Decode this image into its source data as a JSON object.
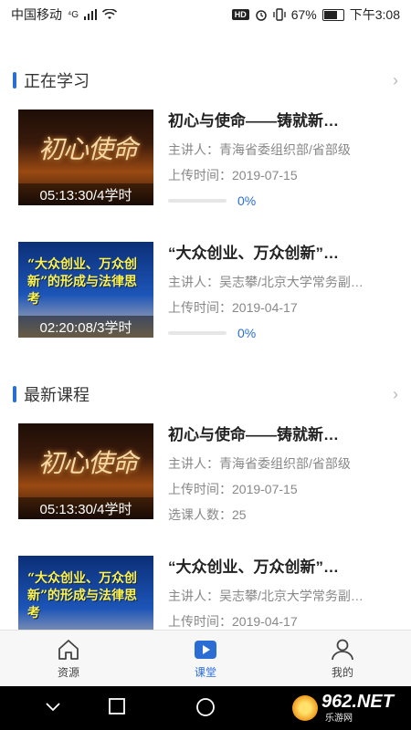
{
  "status": {
    "carrier": "中国移动",
    "network": "⁴G",
    "battery": "67%",
    "time": "下午3:08",
    "hd_badge": "HD"
  },
  "colors": {
    "accent": "#2a6ed4",
    "text": "#222222",
    "muted": "#888888"
  },
  "sections": [
    {
      "title": "正在学习",
      "courses": [
        {
          "title": "初心与使命——铸就新…",
          "speaker": "主讲人：青海省委组织部/省部级",
          "upload": "上传时间：2019-07-15",
          "duration": "05:13:30/4学时",
          "progress": "0%",
          "progress_value": 0,
          "thumb_text": "初心使命"
        },
        {
          "title": "“大众创业、万众创新”…",
          "speaker": "主讲人：吴志攀/北京大学常务副…",
          "upload": "上传时间：2019-04-17",
          "duration": "02:20:08/3学时",
          "progress": "0%",
          "progress_value": 0,
          "thumb_text": "“大众创业、万众创新”的形成与法律思考"
        }
      ]
    },
    {
      "title": "最新课程",
      "courses": [
        {
          "title": "初心与使命——铸就新…",
          "speaker": "主讲人：青海省委组织部/省部级",
          "upload": "上传时间：2019-07-15",
          "duration": "05:13:30/4学时",
          "enrolled": "选课人数：25",
          "thumb_text": "初心使命"
        },
        {
          "title": "“大众创业、万众创新”…",
          "speaker": "主讲人：吴志攀/北京大学常务副…",
          "upload": "上传时间：2019-04-17",
          "thumb_text": "“大众创业、万众创新”的形成与法律思考"
        }
      ]
    }
  ],
  "tabs": [
    {
      "label": "资源",
      "icon": "home-icon"
    },
    {
      "label": "课堂",
      "icon": "play-icon"
    },
    {
      "label": "我的",
      "icon": "user-icon"
    }
  ],
  "watermark": {
    "brand": "962.NET",
    "sub": "乐游网"
  }
}
